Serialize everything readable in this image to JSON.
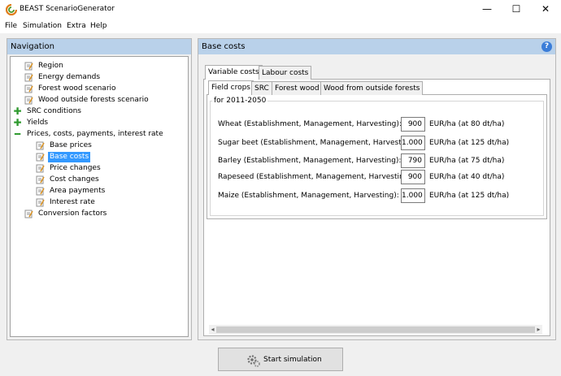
{
  "window": {
    "title": "BEAST ScenarioGenerator",
    "min": "—",
    "max": "☐",
    "close": "✕"
  },
  "menu": [
    "File",
    "Simulation",
    "Extra",
    "Help"
  ],
  "navigation": {
    "title": "Navigation",
    "items": [
      {
        "label": "Region",
        "icon": "page-edit-icon"
      },
      {
        "label": "Energy demands",
        "icon": "page-edit-icon"
      },
      {
        "label": "Forest wood scenario",
        "icon": "page-edit-icon"
      },
      {
        "label": "Wood outside forests scenario",
        "icon": "page-edit-icon"
      },
      {
        "label": "SRC conditions",
        "icon": "expand-plus-icon"
      },
      {
        "label": "Yields",
        "icon": "expand-plus-icon"
      },
      {
        "label": "Prices, costs, payments, interest rate",
        "icon": "collapse-minus-icon"
      },
      {
        "label": "Base prices",
        "icon": "page-edit-icon"
      },
      {
        "label": "Base costs",
        "icon": "page-edit-icon",
        "selected": true
      },
      {
        "label": "Price changes",
        "icon": "page-edit-icon"
      },
      {
        "label": "Cost changes",
        "icon": "page-edit-icon"
      },
      {
        "label": "Area payments",
        "icon": "page-edit-icon"
      },
      {
        "label": "Interest rate",
        "icon": "page-edit-icon"
      },
      {
        "label": "Conversion factors",
        "icon": "page-edit-icon"
      }
    ]
  },
  "base_costs": {
    "title": "Base costs",
    "help": "?",
    "outer_tabs": [
      "Variable costs",
      "Labour costs"
    ],
    "inner_tabs": [
      "Field crops",
      "SRC",
      "Forest wood",
      "Wood from outside forests"
    ],
    "group_title": "for 2011-2050",
    "rows": [
      {
        "label": "Wheat (Establishment, Management, Harvesting):",
        "value": "900",
        "unit": "EUR/ha (at 80   dt/ha)"
      },
      {
        "label": "Sugar beet (Establishment, Management, Harvesting):",
        "value": "1.000",
        "unit": "EUR/ha (at 125 dt/ha)"
      },
      {
        "label": "Barley (Establishment, Management, Harvesting):",
        "value": "790",
        "unit": "EUR/ha (at 75   dt/ha)"
      },
      {
        "label": "Rapeseed (Establishment, Management, Harvesting):",
        "value": "900",
        "unit": "EUR/ha (at 40   dt/ha)"
      },
      {
        "label": "Maize (Establishment, Management, Harvesting):",
        "value": "1.000",
        "unit": "EUR/ha (at 125 dt/ha)"
      }
    ]
  },
  "start_button": "Start simulation",
  "colors": {
    "header": "#b9d1ea",
    "selection": "#3399ff",
    "help": "#3b7dd8"
  }
}
